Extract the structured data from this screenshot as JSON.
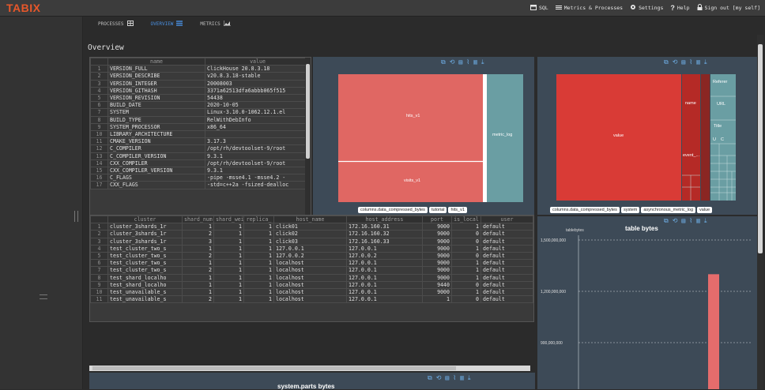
{
  "app": {
    "logo": "TABIX"
  },
  "topnav": [
    {
      "label": "SQL",
      "icon": "sql-icon"
    },
    {
      "label": "Metrics & Processes",
      "icon": "list-icon"
    },
    {
      "label": "Settings",
      "icon": "gear-icon"
    },
    {
      "label": "Help",
      "icon": "help-icon"
    },
    {
      "label": "Sign out [my self]",
      "icon": "lock-icon"
    }
  ],
  "tabs": [
    {
      "label": "PROCESSES",
      "icon": "grid-icon",
      "active": false
    },
    {
      "label": "OVERVIEW",
      "icon": "list-icon",
      "active": true
    },
    {
      "label": "METRICS",
      "icon": "area-chart-icon",
      "active": false
    }
  ],
  "page": {
    "title": "Overview"
  },
  "settings_table": {
    "columns": [
      "name",
      "value"
    ],
    "rows": [
      [
        "1",
        "VERSION_FULL",
        "ClickHouse 20.8.3.18"
      ],
      [
        "2",
        "VERSION_DESCRIBE",
        "v20.8.3.18-stable"
      ],
      [
        "3",
        "VERSION_INTEGER",
        "20008003"
      ],
      [
        "4",
        "VERSION_GITHASH",
        "3371a62513dfa6abbb065f515"
      ],
      [
        "5",
        "VERSION_REVISION",
        "54438"
      ],
      [
        "6",
        "BUILD_DATE",
        "2020-10-05"
      ],
      [
        "7",
        "SYSTEM",
        "Linux-3.10.0-1062.12.1.el"
      ],
      [
        "8",
        "BUILD_TYPE",
        "RelWithDebInfo"
      ],
      [
        "9",
        "SYSTEM_PROCESSOR",
        "x86_64"
      ],
      [
        "10",
        "LIBRARY_ARCHITECTURE",
        ""
      ],
      [
        "11",
        "CMAKE_VERSION",
        "3.17.3"
      ],
      [
        "12",
        "C_COMPILER",
        "/opt/rh/devtoolset-9/root"
      ],
      [
        "13",
        "C_COMPILER_VERSION",
        "9.3.1"
      ],
      [
        "14",
        "CXX_COMPILER",
        "/opt/rh/devtoolset-9/root"
      ],
      [
        "15",
        "CXX_COMPILER_VERSION",
        "9.3.1"
      ],
      [
        "16",
        "C_FLAGS",
        "-pipe -msse4.1 -msse4.2 -"
      ],
      [
        "17",
        "CXX_FLAGS",
        "-std=c++2a -fsized-dealloc"
      ]
    ]
  },
  "clusters_table": {
    "columns": [
      "cluster",
      "shard_num",
      "shard_weight",
      "replica_",
      "host_name",
      "host_address",
      "port",
      "is_local",
      "user"
    ],
    "rows": [
      [
        "1",
        "cluster_3shards_1r",
        "1",
        "1",
        "1",
        "click01",
        "172.16.160.31",
        "9000",
        "1",
        "default"
      ],
      [
        "2",
        "cluster_3shards_1r",
        "2",
        "1",
        "1",
        "click02",
        "172.16.160.32",
        "9000",
        "0",
        "default"
      ],
      [
        "3",
        "cluster_3shards_1r",
        "3",
        "1",
        "1",
        "click03",
        "172.16.160.33",
        "9000",
        "0",
        "default"
      ],
      [
        "4",
        "test_cluster_two_s",
        "1",
        "1",
        "1",
        "127.0.0.1",
        "127.0.0.1",
        "9000",
        "1",
        "default"
      ],
      [
        "5",
        "test_cluster_two_s",
        "2",
        "1",
        "1",
        "127.0.0.2",
        "127.0.0.2",
        "9000",
        "0",
        "default"
      ],
      [
        "6",
        "test_cluster_two_s",
        "1",
        "1",
        "1",
        "localhost",
        "127.0.0.1",
        "9000",
        "1",
        "default"
      ],
      [
        "7",
        "test_cluster_two_s",
        "2",
        "1",
        "1",
        "localhost",
        "127.0.0.1",
        "9000",
        "1",
        "default"
      ],
      [
        "8",
        "test_shard_localho",
        "1",
        "1",
        "1",
        "localhost",
        "127.0.0.1",
        "9000",
        "1",
        "default"
      ],
      [
        "9",
        "test_shard_localho",
        "1",
        "1",
        "1",
        "localhost",
        "127.0.0.1",
        "9440",
        "0",
        "default"
      ],
      [
        "10",
        "test_unavailable_s",
        "1",
        "1",
        "1",
        "localhost",
        "127.0.0.1",
        "9000",
        "1",
        "default"
      ],
      [
        "11",
        "test_unavailable_s",
        "2",
        "1",
        "1",
        "localhost",
        "127.0.0.1",
        "1",
        "0",
        "default"
      ]
    ]
  },
  "treemap_left": {
    "labels": [
      "hits_v1",
      "visits_v1",
      "metric_log"
    ],
    "breadcrumb": [
      "columns.data_compressed_bytes",
      "tutorial",
      "hits_v1"
    ]
  },
  "treemap_right": {
    "labels": [
      "value",
      "name",
      "event_...",
      "Referer",
      "URL",
      "Title",
      "U",
      "C"
    ],
    "breadcrumb": [
      "columns.data_compressed_bytes",
      "system",
      "asynchronous_metric_log",
      "value"
    ]
  },
  "bar_chart": {
    "title": "table bytes",
    "legend": "tablebytes",
    "ticks": [
      "1,500,000,000",
      "1,200,000,000",
      "900,000,000"
    ]
  },
  "footer_panel": {
    "title": "system.parts bytes"
  },
  "colors": {
    "accent": "#e8572a",
    "treemap_red": "#e06763",
    "treemap_teal": "#6a9ea3",
    "bar": "#e56c6c",
    "panel": "#3d4a57"
  },
  "chart_data": {
    "type": "bar",
    "title": "table bytes",
    "series": [
      {
        "name": "tablebytes",
        "values": [
          1300000000
        ]
      }
    ],
    "ylim": [
      900000000,
      1500000000
    ]
  }
}
